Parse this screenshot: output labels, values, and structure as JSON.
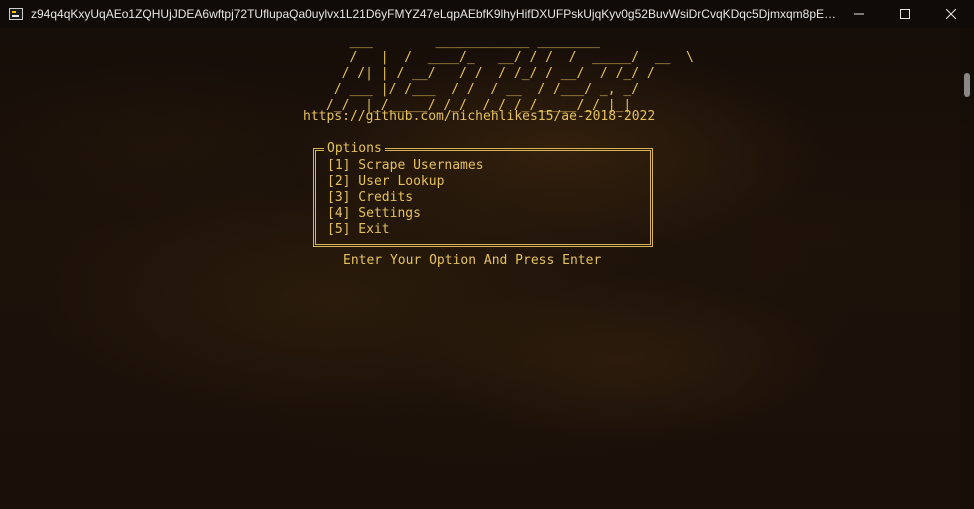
{
  "window": {
    "title": "z94q4qKxyUqAEo1ZQHUjJDEA6wftpj72TUflupaQa0uylvx1L21D6yFMYZ47eLqpAEbfK9lhyHifDXUFPskUjqKyv0g52BuvWsiDrCvqKDqc5Djmxqm8pEOIIEDD...",
    "controls": {
      "minimize_icon": "minimize-icon",
      "maximize_icon": "maximize-icon",
      "close_icon": "close-icon"
    }
  },
  "terminal": {
    "banner_art": "   ___        ____________ ________\n   /   |  /  ____/_   __/ / /  /  _____/  __  \\\n  / /| | / __/   / /  / /_/ / __/  / /_/ /\n / ___ |/ /___  / /  / __  / /___/ _, _/\n/_/  |_/_____/ /_/  /_/ /_/_____/_/ |_|",
    "url": "https://github.com/nichehlikes15/ae-2018-2022",
    "options_title": "Options",
    "options": [
      "[1] Scrape Usernames",
      "[2] User Lookup",
      "[3] Credits",
      "[4] Settings",
      "[5] Exit"
    ],
    "prompt": "Enter Your Option And Press Enter"
  },
  "colors": {
    "terminal_text": "#e5c25c",
    "box_border": "#d9b55a",
    "titlebar_bg": "#100b08"
  }
}
